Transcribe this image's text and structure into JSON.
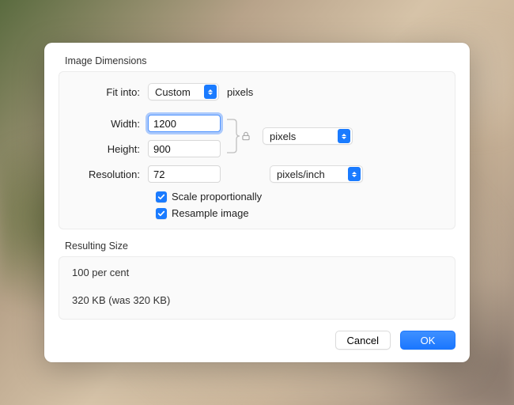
{
  "section1_title": "Image Dimensions",
  "fit_into_label": "Fit into:",
  "fit_into_value": "Custom",
  "fit_into_unit": "pixels",
  "width_label": "Width:",
  "width_value": "1200",
  "height_label": "Height:",
  "height_value": "900",
  "wh_unit_value": "pixels",
  "resolution_label": "Resolution:",
  "resolution_value": "72",
  "resolution_unit_value": "pixels/inch",
  "scale_label": "Scale proportionally",
  "resample_label": "Resample image",
  "section2_title": "Resulting Size",
  "result_percent": "100 per cent",
  "result_size": "320 KB (was 320 KB)",
  "cancel_label": "Cancel",
  "ok_label": "OK"
}
